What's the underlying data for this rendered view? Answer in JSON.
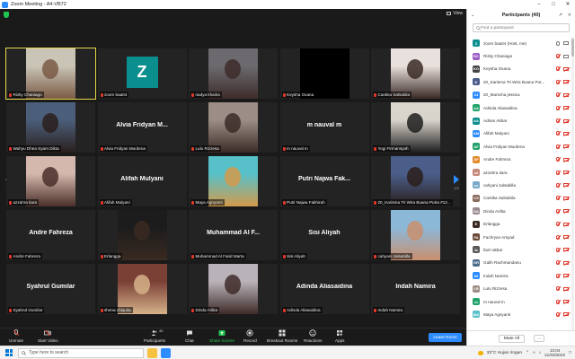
{
  "window": {
    "title": "Zoom Meeting - A4-VB72"
  },
  "header": {
    "view_label": "View"
  },
  "pager": {
    "left": "1/2",
    "right": "1/2"
  },
  "tiles": [
    {
      "name": "Rizky Chaniago",
      "display": "photo",
      "bg": "#c9c4b6",
      "fg": "#7a5b45",
      "active": true
    },
    {
      "name": "zoom baa04",
      "display": "avatar",
      "avatar_letter": "Z"
    },
    {
      "name": "nadya khairia",
      "display": "photo",
      "bg": "#6c6a6e",
      "fg": "#3d2c2a"
    },
    {
      "name": "Keysha Oxana",
      "display": "black"
    },
    {
      "name": "Cantika Salsabila",
      "display": "photo",
      "bg": "#e8e0dc",
      "fg": "#3a2a26"
    },
    {
      "name": "Wahyu Dhea Syam Dikta",
      "display": "photo",
      "bg": "#4b5f7a",
      "fg": "#2a1f1c"
    },
    {
      "name": "Alvia Fridyan Murdena",
      "display": "text",
      "big": "Alvia Fridyan M..."
    },
    {
      "name": "Lulu Rizzesa",
      "display": "photo",
      "bg": "#9c8e86",
      "fg": "#3b2b27"
    },
    {
      "name": "m nauval m",
      "display": "text",
      "big": "m nauval m"
    },
    {
      "name": "Yogi Firmansyah",
      "display": "photo",
      "bg": "#d9d4cc",
      "fg": "#1e1e1e"
    },
    {
      "name": "azzahra tiara",
      "display": "photo",
      "bg": "#d4b7ad",
      "fg": "#4a302a"
    },
    {
      "name": "Alifah Mulyani",
      "display": "text",
      "big": "Alifah Mulyani"
    },
    {
      "name": "Maya Agnyanti",
      "display": "photo",
      "bg": "#57c0c8",
      "fg": "#d39a4b"
    },
    {
      "name": "Putri Najwa Fakhirah",
      "display": "text",
      "big": "Putri Najwa Fak..."
    },
    {
      "name": "20_Karisma Tri Wira Buana Putra #12...",
      "display": "photo",
      "bg": "#4b5e8a",
      "fg": "#2a1d1a"
    },
    {
      "name": "Andre Fahreza",
      "display": "text",
      "big": "Andre Fahreza"
    },
    {
      "name": "Erlangga",
      "display": "photo",
      "bg": "#1c1c1c",
      "fg": "#3a2a22"
    },
    {
      "name": "Muhammad Al Farid Marta",
      "display": "text",
      "big": "Muhammad Al F..."
    },
    {
      "name": "Sisi Aliyah",
      "display": "text",
      "big": "Sisi Aliyah"
    },
    {
      "name": "cahyani zalsabilla",
      "display": "photo",
      "bg": "#8cb8d8",
      "fg": "#c98f6f"
    },
    {
      "name": "Syahrul Gumilar",
      "display": "text",
      "big": "Syahrul Gumilar"
    },
    {
      "name": "shena chiquita",
      "display": "photo",
      "bg": "#7a4036",
      "fg": "#d6b28a"
    },
    {
      "name": "Dinda Arilita",
      "display": "photo",
      "bg": "#b9b2b8",
      "fg": "#3e2b29"
    },
    {
      "name": "Adinda Aliasaidina",
      "display": "text",
      "big": "Adinda Aliasaidina"
    },
    {
      "name": "Indah Namira",
      "display": "text",
      "big": "Indah Namira"
    }
  ],
  "toolbar": {
    "unmute": "Unmute",
    "start_video": "Start Video",
    "participants": "Participants",
    "participants_count": "40",
    "chat": "Chat",
    "share_screen": "Share Screen",
    "record": "Record",
    "breakout": "Breakout Rooms",
    "reactions": "Reactions",
    "apps": "Apps",
    "leave": "Leave Room"
  },
  "panel": {
    "title": "Participants (40)",
    "search_placeholder": "Find a participant",
    "mute_all": "Mute All",
    "more": "...",
    "participants": [
      {
        "name": "zoom baa04 (Host, me)",
        "initials": "Z",
        "color": "#0b8e8e",
        "mic": "on",
        "cam": "on"
      },
      {
        "name": "Rizky Chaniago",
        "initials": "RC",
        "color": "#9b5cc7",
        "mic": "off",
        "cam": "on"
      },
      {
        "name": "Keysha Oxana",
        "initials": "KO",
        "color": "#444444",
        "mic": "off",
        "cam": "off"
      },
      {
        "name": "20_Karisma Tri Wira Buana Put...",
        "initials": "K",
        "color": "#4b5e8a",
        "mic": "off",
        "cam": "off"
      },
      {
        "name": "20_Marscha jessica",
        "initials": "2J",
        "color": "#2d8cff",
        "mic": "off",
        "cam": "off"
      },
      {
        "name": "Adinda Aliasaidina",
        "initials": "AA",
        "color": "#23a36a",
        "mic": "off",
        "cam": "off"
      },
      {
        "name": "Adrian Akbar",
        "initials": "AA",
        "color": "#0b8e8e",
        "mic": "off",
        "cam": "off"
      },
      {
        "name": "Alifah Mulyani",
        "initials": "AM",
        "color": "#2d8cff",
        "mic": "off",
        "cam": "off"
      },
      {
        "name": "Alvia Fridyan Murdena",
        "initials": "AF",
        "color": "#23a36a",
        "mic": "off",
        "cam": "off"
      },
      {
        "name": "Andre Fahreza",
        "initials": "AF",
        "color": "#e58a2a",
        "mic": "off",
        "cam": "off"
      },
      {
        "name": "azzahra tiara",
        "initials": "at",
        "color": "#c58a7a",
        "mic": "off",
        "cam": "off"
      },
      {
        "name": "cahyani zalsabilla",
        "initials": "cz",
        "color": "#7aa8c8",
        "mic": "off",
        "cam": "off"
      },
      {
        "name": "Cantika Salsabila",
        "initials": "CS",
        "color": "#8a6a5a",
        "mic": "off",
        "cam": "off"
      },
      {
        "name": "Dinda Arilita",
        "initials": "DA",
        "color": "#9a8a90",
        "mic": "off",
        "cam": "off"
      },
      {
        "name": "Erlangga",
        "initials": "E",
        "color": "#3a2a22",
        "mic": "off",
        "cam": "off"
      },
      {
        "name": "Fachryan Arsyad",
        "initials": "FA",
        "color": "#6a4a3a",
        "mic": "off",
        "cam": "off"
      },
      {
        "name": "fazri akbar",
        "initials": "fa",
        "color": "#5a5a5a",
        "mic": "off",
        "cam": "off"
      },
      {
        "name": "Galih Rachmandanu",
        "initials": "GR",
        "color": "#4a6a8a",
        "mic": "off",
        "cam": "off"
      },
      {
        "name": "Indah Namira",
        "initials": "IN",
        "color": "#2d8cff",
        "mic": "off",
        "cam": "off"
      },
      {
        "name": "Lulu Rizzesa",
        "initials": "LR",
        "color": "#9c8e86",
        "mic": "off",
        "cam": "off"
      },
      {
        "name": "m nauval m",
        "initials": "m",
        "color": "#23a36a",
        "mic": "off",
        "cam": "off"
      },
      {
        "name": "Maya Agnyanti",
        "initials": "MA",
        "color": "#57c0c8",
        "mic": "off",
        "cam": "off"
      }
    ]
  },
  "taskbar": {
    "search_placeholder": "Type here to search",
    "weather": "33°C Hujan ringan",
    "time": "13:04",
    "date": "21/03/2022"
  }
}
